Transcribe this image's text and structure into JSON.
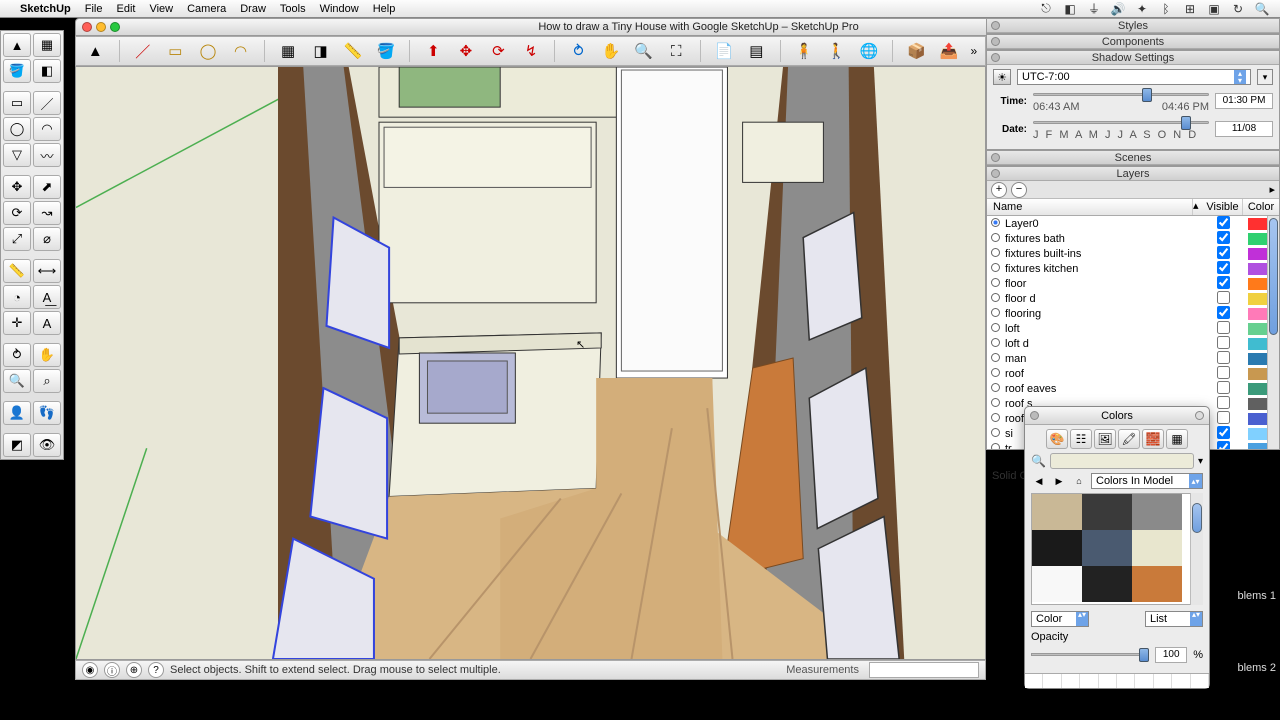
{
  "menubar": {
    "app": "SketchUp",
    "items": [
      "File",
      "Edit",
      "View",
      "Camera",
      "Draw",
      "Tools",
      "Window",
      "Help"
    ]
  },
  "window": {
    "title": "How to draw a Tiny House with Google SketchUp – SketchUp Pro"
  },
  "status": {
    "hint": "Select objects. Shift to extend select. Drag mouse to select multiple.",
    "measurements_label": "Measurements"
  },
  "trays": {
    "styles": "Styles",
    "components": "Components",
    "shadow": "Shadow Settings",
    "scenes": "Scenes",
    "layers": "Layers"
  },
  "shadow": {
    "tz": "UTC-7:00",
    "time_label": "Time:",
    "time_start": "06:43 AM",
    "time_end": "04:46 PM",
    "time_value": "01:30 PM",
    "date_label": "Date:",
    "date_months": "J F M A M J J A S O N D",
    "date_value": "11/08"
  },
  "layers": {
    "columns": {
      "name": "Name",
      "visible": "Visible",
      "color": "Color"
    },
    "items": [
      {
        "name": "Layer0",
        "visible": true,
        "color": "#ff3030",
        "active": true
      },
      {
        "name": "fixtures bath",
        "visible": true,
        "color": "#2fd070"
      },
      {
        "name": "fixtures built-ins",
        "visible": true,
        "color": "#c030d8"
      },
      {
        "name": "fixtures kitchen",
        "visible": true,
        "color": "#b050e0"
      },
      {
        "name": "floor",
        "visible": true,
        "color": "#ff7a1a"
      },
      {
        "name": "floor d",
        "visible": false,
        "color": "#f0d040"
      },
      {
        "name": "flooring",
        "visible": true,
        "color": "#ff7ab8"
      },
      {
        "name": "loft",
        "visible": false,
        "color": "#66d090"
      },
      {
        "name": "loft d",
        "visible": false,
        "color": "#40bcd0"
      },
      {
        "name": "man",
        "visible": false,
        "color": "#2a7ab0"
      },
      {
        "name": "roof",
        "visible": false,
        "color": "#c89850"
      },
      {
        "name": "roof eaves",
        "visible": false,
        "color": "#3a9a7a"
      },
      {
        "name": "roof s",
        "visible": false,
        "color": "#606060"
      },
      {
        "name": "roofing",
        "visible": false,
        "color": "#4a60d0"
      },
      {
        "name": "si",
        "visible": true,
        "color": "#80d0ff"
      },
      {
        "name": "tr",
        "visible": true,
        "color": "#4aa0e0"
      }
    ]
  },
  "colors": {
    "title": "Colors",
    "dropdown": "Colors In Model",
    "color_label": "Color",
    "list_label": "List",
    "opacity_label": "Opacity",
    "opacity_value": "100",
    "opacity_pct": "%",
    "swatches": [
      "#c9b896",
      "#3a3a3a",
      "#8a8a8a",
      "#1a1a1a",
      "#4a5a70",
      "#e8e6ce",
      "#f8f8f8",
      "#222222",
      "#c97a3a"
    ]
  },
  "right_labels": {
    "solid": "Solid C",
    "problems1": "blems 1",
    "problems2": "blems 2"
  }
}
